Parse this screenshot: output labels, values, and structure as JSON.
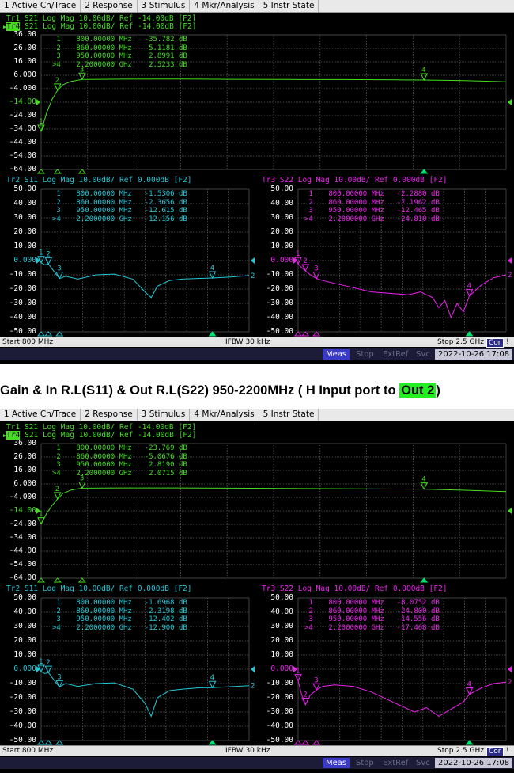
{
  "menu": [
    "1 Active Ch/Trace",
    "2 Response",
    "3 Stimulus",
    "4 Mkr/Analysis",
    "5 Instr State"
  ],
  "caption": {
    "text": "Gain & In R.L(S11) & Out R.L(S22) 950-2200MHz ( H Input port to ",
    "highlight": "Out 2",
    "end": ")"
  },
  "colors": {
    "s21": "#44dd22",
    "s11": "#22c8d8",
    "s22": "#ee22ee",
    "grid": "#5a5a5a",
    "marker_active": "#00e070"
  },
  "screens": [
    {
      "status": {
        "start": "Start 800 MHz",
        "ifbw": "IFBW 30 kHz",
        "stop": "Stop 2.5 GHz",
        "cor": "Cor",
        "bang": "!"
      },
      "info": {
        "meas": "Meas",
        "stop": "Stop",
        "extref": "ExtRef",
        "svc": "Svc",
        "datetime": "2022-10-26 17:08"
      },
      "panels": [
        {
          "id": "s21",
          "title1": "Tr1 S21 Log Mag 10.00dB/ Ref -14.00dB [F2]",
          "title2_tag": "Tr4",
          "title2": " S21 Log Mag 10.00dB/ Ref -14.00dB [F2]",
          "ticks": [
            "36.00",
            "26.00",
            "16.00",
            "6.000",
            "-4.000",
            "-14.00",
            "-24.00",
            "-34.00",
            "-44.00",
            "-54.00",
            "-64.00"
          ],
          "ref_tick": 5,
          "markers": [
            {
              "n": " 1",
              "f": "800.00000 MHz",
              "v": "-35.782 dB"
            },
            {
              "n": " 2",
              "f": "860.00000 MHz",
              "v": "-5.1181 dB"
            },
            {
              "n": " 3",
              "f": "950.00000 MHz",
              "v": "2.8991 dB"
            },
            {
              "n": ">4",
              "f": "2.2000000 GHz",
              "v": "2.5233 dB"
            }
          ],
          "trace": [
            [
              800,
              -35.8
            ],
            [
              820,
              -22
            ],
            [
              840,
              -12
            ],
            [
              860,
              -5.1
            ],
            [
              880,
              -1
            ],
            [
              910,
              1.5
            ],
            [
              950,
              2.9
            ],
            [
              1100,
              3.1
            ],
            [
              1300,
              3.2
            ],
            [
              1500,
              3.0
            ],
            [
              1700,
              2.9
            ],
            [
              1900,
              2.8
            ],
            [
              2100,
              2.6
            ],
            [
              2200,
              2.5
            ],
            [
              2350,
              2.0
            ],
            [
              2500,
              1.2
            ]
          ],
          "marker_points": [
            [
              800,
              -35.8,
              "1"
            ],
            [
              860,
              -5.1,
              "2"
            ],
            [
              950,
              2.9,
              "3"
            ],
            [
              2200,
              2.5,
              "4"
            ]
          ]
        },
        {
          "id": "s11",
          "title1": "Tr2 S11 Log Mag 10.00dB/ Ref 0.000dB [F2]",
          "ticks": [
            "50.00",
            "40.00",
            "30.00",
            "20.00",
            "10.00",
            "0.000",
            "-10.00",
            "-20.00",
            "-30.00",
            "-40.00",
            "-50.00"
          ],
          "ref_tick": 5,
          "markers": [
            {
              "n": " 1",
              "f": "800.00000 MHz",
              "v": "-1.5306 dB"
            },
            {
              "n": " 2",
              "f": "860.00000 MHz",
              "v": "-2.3656 dB"
            },
            {
              "n": " 3",
              "f": "950.00000 MHz",
              "v": "-12.615 dB"
            },
            {
              "n": ">4",
              "f": "2.2000000 GHz",
              "v": "-12.156 dB"
            }
          ],
          "trace": [
            [
              800,
              -1.5
            ],
            [
              830,
              -3
            ],
            [
              860,
              -2.4
            ],
            [
              900,
              -7
            ],
            [
              950,
              -12.6
            ],
            [
              1000,
              -11
            ],
            [
              1100,
              -13
            ],
            [
              1250,
              -10
            ],
            [
              1400,
              -9.5
            ],
            [
              1550,
              -13
            ],
            [
              1650,
              -22
            ],
            [
              1700,
              -26
            ],
            [
              1750,
              -18
            ],
            [
              1850,
              -14
            ],
            [
              1950,
              -13
            ],
            [
              2100,
              -12.5
            ],
            [
              2200,
              -12.2
            ],
            [
              2350,
              -11.5
            ],
            [
              2500,
              -10.5
            ]
          ],
          "marker_points": [
            [
              800,
              -1.5,
              "1"
            ],
            [
              860,
              -2.4,
              "2"
            ],
            [
              950,
              -12.6,
              "3"
            ],
            [
              2200,
              -12.2,
              "4"
            ]
          ]
        },
        {
          "id": "s22",
          "title1": "Tr3 S22 Log Mag 10.00dB/ Ref 0.000dB [F2]",
          "ticks": [
            "50.00",
            "40.00",
            "30.00",
            "20.00",
            "10.00",
            "0.000",
            "-10.00",
            "-20.00",
            "-30.00",
            "-40.00",
            "-50.00"
          ],
          "ref_tick": 5,
          "markers": [
            {
              "n": " 1",
              "f": "800.00000 MHz",
              "v": "-2.2880 dB"
            },
            {
              "n": " 2",
              "f": "860.00000 MHz",
              "v": "-7.1962 dB"
            },
            {
              "n": " 3",
              "f": "950.00000 MHz",
              "v": "-12.465 dB"
            },
            {
              "n": ">4",
              "f": "2.2000000 GHz",
              "v": "-24.810 dB"
            }
          ],
          "trace": [
            [
              800,
              -2.3
            ],
            [
              830,
              -5
            ],
            [
              860,
              -7.2
            ],
            [
              900,
              -10
            ],
            [
              950,
              -12.5
            ],
            [
              1000,
              -14
            ],
            [
              1100,
              -16
            ],
            [
              1250,
              -19
            ],
            [
              1400,
              -22
            ],
            [
              1550,
              -23
            ],
            [
              1700,
              -24
            ],
            [
              1800,
              -22
            ],
            [
              1900,
              -26
            ],
            [
              1950,
              -33
            ],
            [
              2000,
              -28
            ],
            [
              2050,
              -40
            ],
            [
              2100,
              -30
            ],
            [
              2150,
              -36
            ],
            [
              2200,
              -24.8
            ],
            [
              2300,
              -17
            ],
            [
              2400,
              -12
            ],
            [
              2500,
              -10
            ]
          ],
          "marker_points": [
            [
              800,
              -2.3,
              "1"
            ],
            [
              860,
              -7.2,
              "2"
            ],
            [
              950,
              -12.5,
              "3"
            ],
            [
              2200,
              -24.8,
              "4"
            ]
          ]
        }
      ]
    },
    {
      "status": {
        "start": "Start 800 MHz",
        "ifbw": "IFBW 30 kHz",
        "stop": "Stop 2.5 GHz",
        "cor": "Cor",
        "bang": "!"
      },
      "info": {
        "meas": "Meas",
        "stop": "Stop",
        "extref": "ExtRef",
        "svc": "Svc",
        "datetime": "2022-10-26 17:08"
      },
      "panels": [
        {
          "id": "s21",
          "title1": "Tr1 S21 Log Mag 10.00dB/ Ref -14.00dB [F2]",
          "title2_tag": "Tr4",
          "title2": " S21 Log Mag 10.00dB/ Ref -14.00dB [F2]",
          "ticks": [
            "36.00",
            "26.00",
            "16.00",
            "6.000",
            "-4.000",
            "-14.00",
            "-24.00",
            "-34.00",
            "-44.00",
            "-54.00",
            "-64.00"
          ],
          "ref_tick": 5,
          "markers": [
            {
              "n": " 1",
              "f": "800.00000 MHz",
              "v": "-23.769 dB"
            },
            {
              "n": " 2",
              "f": "860.00000 MHz",
              "v": "-5.0676 dB"
            },
            {
              "n": " 3",
              "f": "950.00000 MHz",
              "v": "2.8190 dB"
            },
            {
              "n": ">4",
              "f": "2.2000000 GHz",
              "v": "2.0715 dB"
            }
          ],
          "trace": [
            [
              800,
              -23.8
            ],
            [
              820,
              -16
            ],
            [
              840,
              -10
            ],
            [
              860,
              -5.1
            ],
            [
              880,
              -1
            ],
            [
              910,
              1.5
            ],
            [
              950,
              2.8
            ],
            [
              1100,
              3.0
            ],
            [
              1300,
              3.0
            ],
            [
              1500,
              2.8
            ],
            [
              1700,
              2.6
            ],
            [
              1900,
              2.4
            ],
            [
              2100,
              2.2
            ],
            [
              2200,
              2.1
            ],
            [
              2350,
              1.3
            ],
            [
              2500,
              0.3
            ]
          ],
          "marker_points": [
            [
              800,
              -23.8,
              "1"
            ],
            [
              860,
              -5.1,
              "2"
            ],
            [
              950,
              2.8,
              "3"
            ],
            [
              2200,
              2.1,
              "4"
            ]
          ]
        },
        {
          "id": "s11",
          "title1": "Tr2 S11 Log Mag 10.00dB/ Ref 0.000dB [F2]",
          "ticks": [
            "50.00",
            "40.00",
            "30.00",
            "20.00",
            "10.00",
            "0.000",
            "-10.00",
            "-20.00",
            "-30.00",
            "-40.00",
            "-50.00"
          ],
          "ref_tick": 5,
          "markers": [
            {
              "n": " 1",
              "f": "800.00000 MHz",
              "v": "-1.6968 dB"
            },
            {
              "n": " 2",
              "f": "860.00000 MHz",
              "v": "-2.3198 dB"
            },
            {
              "n": " 3",
              "f": "950.00000 MHz",
              "v": "-12.402 dB"
            },
            {
              "n": ">4",
              "f": "2.2000000 GHz",
              "v": "-12.900 dB"
            }
          ],
          "trace": [
            [
              800,
              -1.7
            ],
            [
              830,
              -3
            ],
            [
              860,
              -2.3
            ],
            [
              900,
              -7
            ],
            [
              950,
              -12.4
            ],
            [
              1000,
              -10
            ],
            [
              1100,
              -12
            ],
            [
              1250,
              -10
            ],
            [
              1400,
              -9.5
            ],
            [
              1550,
              -14
            ],
            [
              1650,
              -24
            ],
            [
              1700,
              -33
            ],
            [
              1750,
              -20
            ],
            [
              1850,
              -15
            ],
            [
              1950,
              -14
            ],
            [
              2100,
              -13
            ],
            [
              2200,
              -12.9
            ],
            [
              2350,
              -12.2
            ],
            [
              2500,
              -11.5
            ]
          ],
          "marker_points": [
            [
              800,
              -1.7,
              "1"
            ],
            [
              860,
              -2.3,
              "2"
            ],
            [
              950,
              -12.4,
              "3"
            ],
            [
              2200,
              -12.9,
              "4"
            ]
          ]
        },
        {
          "id": "s22",
          "title1": "Tr3 S22 Log Mag 10.00dB/ Ref 0.000dB [F2]",
          "ticks": [
            "50.00",
            "40.00",
            "30.00",
            "20.00",
            "10.00",
            "0.000",
            "-10.00",
            "-20.00",
            "-30.00",
            "-40.00",
            "-50.00"
          ],
          "ref_tick": 5,
          "markers": [
            {
              "n": " 1",
              "f": "800.00000 MHz",
              "v": "-8.0752 dB"
            },
            {
              "n": " 2",
              "f": "860.00000 MHz",
              "v": "-24.800 dB"
            },
            {
              "n": " 3",
              "f": "950.00000 MHz",
              "v": "-14.556 dB"
            },
            {
              "n": ">4",
              "f": "2.2000000 GHz",
              "v": "-17.468 dB"
            }
          ],
          "trace": [
            [
              800,
              -8.1
            ],
            [
              830,
              -18
            ],
            [
              860,
              -24.8
            ],
            [
              900,
              -18
            ],
            [
              950,
              -14.6
            ],
            [
              1000,
              -12
            ],
            [
              1100,
              -11
            ],
            [
              1250,
              -12
            ],
            [
              1400,
              -16
            ],
            [
              1550,
              -22
            ],
            [
              1650,
              -26
            ],
            [
              1750,
              -30
            ],
            [
              1850,
              -27
            ],
            [
              1950,
              -33
            ],
            [
              2050,
              -28
            ],
            [
              2150,
              -23
            ],
            [
              2200,
              -17.5
            ],
            [
              2300,
              -13
            ],
            [
              2400,
              -10
            ],
            [
              2500,
              -9
            ]
          ],
          "marker_points": [
            [
              800,
              -8.1,
              "1"
            ],
            [
              860,
              -24.8,
              "2"
            ],
            [
              950,
              -14.6,
              "3"
            ],
            [
              2200,
              -17.5,
              "4"
            ]
          ]
        }
      ]
    }
  ]
}
